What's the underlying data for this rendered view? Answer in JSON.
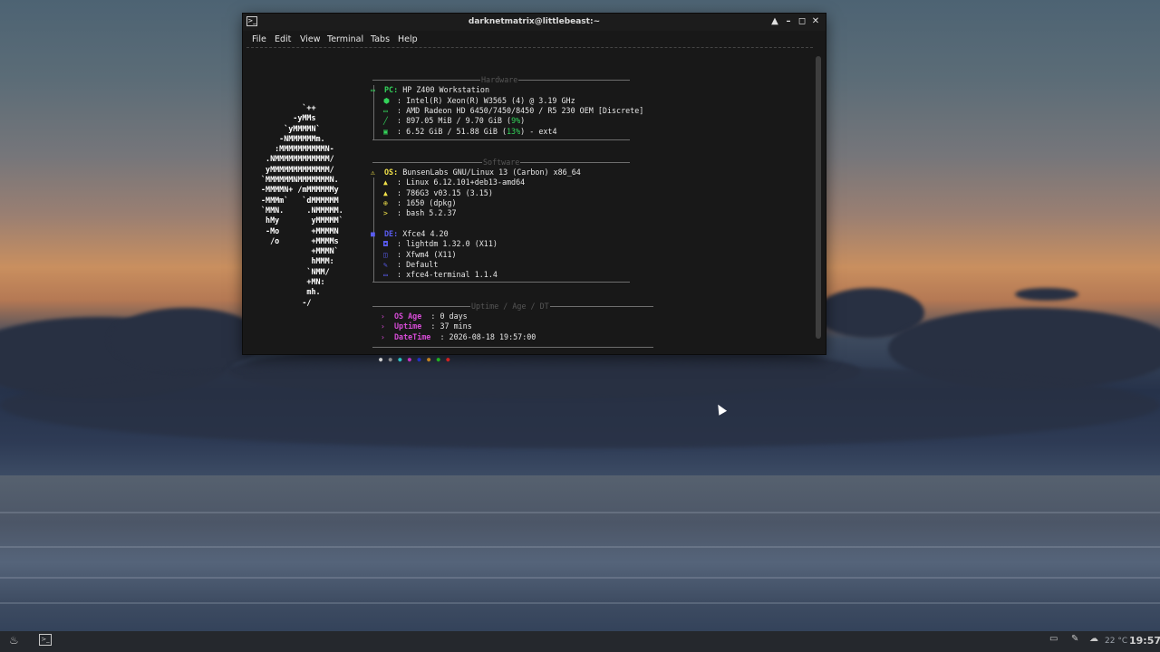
{
  "window": {
    "title": "darknetmatrix@littlebeast:~",
    "buttons": [
      "▲",
      "–",
      "◻",
      "✕"
    ]
  },
  "menu": [
    "File",
    "Edit",
    "View",
    "Terminal",
    "Tabs",
    "Help"
  ],
  "ascii_logo": "         `++\n       -yMMs\n     `yMMMMN`\n    -NMMMMMMm.\n   :MMMMMMMMMMN-\n .NMMMMMMMMMMMM/\n yMMMMMMMMMMMMM/\n`MMMMMMNMMMMMMMN.\n-MMMMN+ /mMMMMMMy\n-MMMm`   `dMMMMMM\n`MMN.     .NMMMMM.\n hMy       yMMMMM`\n -Mo       +MMMMN\n  /o       +MMMMs\n           +MMMN`\n           hMMM:\n          `NMM/\n          +MN:\n          mh.\n         -/",
  "sections": {
    "hardware": "Hardware",
    "software": "Software",
    "uptime": "Uptime / Age / DT"
  },
  "hardware": {
    "pc_label": "PC:",
    "pc_value": "HP Z400 Workstation",
    "cpu": ": Intel(R) Xeon(R) W3565 (4) @ 3.19 GHz",
    "gpu": ": AMD Radeon HD 6450/7450/8450 / R5 230 OEM [Discrete]",
    "mem_prefix": ": 897.05 MiB / 9.70 GiB (",
    "mem_pct": "9%",
    "mem_suffix": ")",
    "disk_prefix": ": 6.52 GiB / 51.88 GiB (",
    "disk_pct": "13%",
    "disk_suffix": ") - ext4"
  },
  "software": {
    "os_label": "OS:",
    "os_value": "BunsenLabs GNU/Linux 13 (Carbon) x86_64",
    "kernel": ": Linux 6.12.101+deb13-amd64",
    "bl": ": 786G3 v03.15 (3.15)",
    "packages": ": 1650 (dpkg)",
    "shell": ": bash 5.2.37",
    "de_label": "DE:",
    "de_value": "Xfce4 4.20",
    "dm": ": lightdm 1.32.0 (X11)",
    "wm": ": Xfwm4 (X11)",
    "theme": ": Default",
    "terminal": ": xfce4-terminal 1.1.4"
  },
  "uptime": {
    "age_label": "OS Age",
    "age_value": ": 0 days",
    "uptime_label": "Uptime",
    "uptime_value": ": 37 mins",
    "dt_label": "DateTime",
    "dt_value": ": 2026-08-18 19:57:00"
  },
  "palette_dots": [
    "#cfcfcf",
    "#8a8a8a",
    "#2bc0c0",
    "#c030c0",
    "#2030c0",
    "#c08020",
    "#20b020",
    "#d02020"
  ],
  "taskbar": {
    "temperature": "22 °C",
    "clock": "19:57"
  }
}
